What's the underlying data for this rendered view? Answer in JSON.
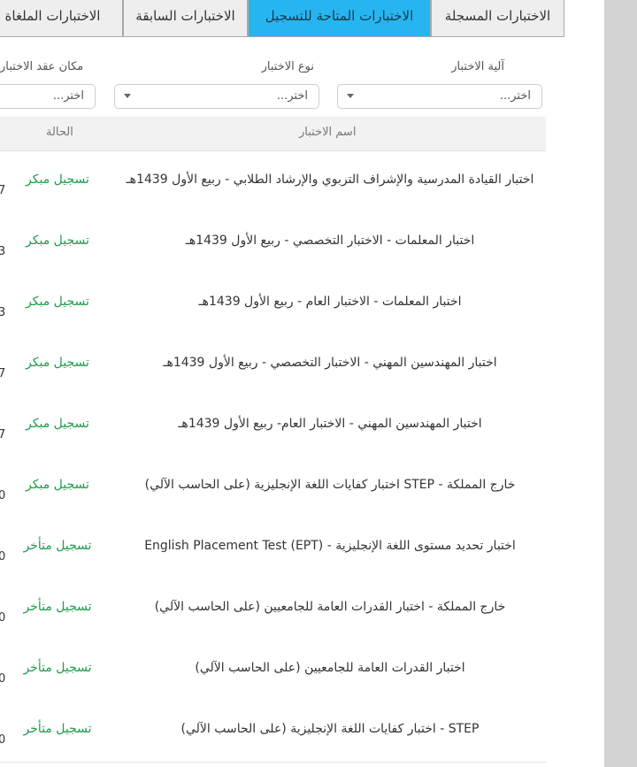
{
  "tabs": [
    {
      "label": "الاختبارات المسجلة",
      "active": false
    },
    {
      "label": "الاختبارات المتاحة للتسجيل",
      "active": true
    },
    {
      "label": "الاختبارات السابقة",
      "active": false
    },
    {
      "label": "الاختبارات الملغاة",
      "active": false
    }
  ],
  "filters": {
    "mechanism": {
      "label": "آلية الاختبار",
      "placeholder": "اختر..."
    },
    "type": {
      "label": "نوع الاختبار",
      "placeholder": "اختر..."
    },
    "place": {
      "label": "مكان عقد الاختبار",
      "placeholder": "اختر..."
    }
  },
  "table": {
    "headers": {
      "name": "اسم الاختبار",
      "status": "الحالة"
    },
    "rows": [
      {
        "name": "اختبار القيادة المدرسية والإشراف التربوي والإرشاد الطلابي - ربيع الأول 1439هـ",
        "status": "تسجيل مبكر",
        "edge": "7"
      },
      {
        "name": "اختبار المعلمات - الاختبار التخصصي - ربيع الأول 1439هـ",
        "status": "تسجيل مبكر",
        "edge": "3"
      },
      {
        "name": "اختبار المعلمات - الاختبار العام - ربيع الأول 1439هـ",
        "status": "تسجيل مبكر",
        "edge": "3"
      },
      {
        "name": "اختبار المهندسين المهني - الاختبار التخصصي - ربيع الأول 1439هـ",
        "status": "تسجيل مبكر",
        "edge": "7"
      },
      {
        "name": "اختبار المهندسين المهني - الاختبار العام- ربيع الأول 1439هـ",
        "status": "تسجيل مبكر",
        "edge": "7"
      },
      {
        "name": "خارج المملكة - STEP اختبار كفايات اللغة الإنجليزية (على الحاسب الآلي)",
        "status": "تسجيل مبكر",
        "edge": "0"
      },
      {
        "name": "اختبار تحديد مستوى اللغة الإنجليزية - English Placement Test (EPT)",
        "status": "تسجيل متأخر",
        "edge": "0"
      },
      {
        "name": "خارج المملكة - اختبار القدرات العامة للجامعيين (على الحاسب الآلي)",
        "status": "تسجيل متأخر",
        "edge": "0"
      },
      {
        "name": "اختبار القدرات العامة للجامعيين (على الحاسب الآلي)",
        "status": "تسجيل متأخر",
        "edge": "0"
      },
      {
        "name": "STEP - اختبار كفايات اللغة الإنجليزية (على الحاسب الآلي)",
        "status": "تسجيل متأخر",
        "edge": "0"
      }
    ]
  }
}
